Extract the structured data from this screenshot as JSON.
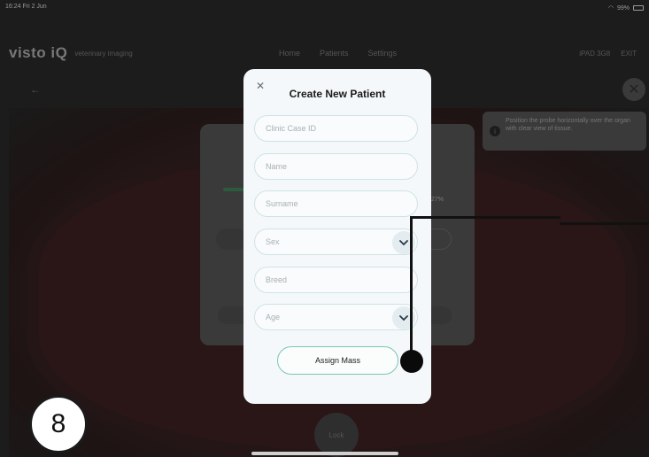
{
  "status_bar": {
    "time": "16:24  Fri 2 Jun",
    "battery": "99%"
  },
  "app": {
    "logo": "visto iQ",
    "logo_sub": "veterinary imaging",
    "nav": [
      "Home",
      "Patients",
      "Settings"
    ],
    "right_items": [
      "iPAD 3G8",
      "EXIT"
    ]
  },
  "info_box": {
    "text": "Position the probe horizontally over the organ with clear view of tissue."
  },
  "background_card": {
    "progress_label": "27%"
  },
  "modal": {
    "title": "Create New Patient",
    "close_icon": "close-icon",
    "fields": {
      "clinic_case_id": {
        "placeholder": "Clinic Case ID",
        "value": ""
      },
      "name": {
        "placeholder": "Name",
        "value": ""
      },
      "surname": {
        "placeholder": "Surname",
        "value": ""
      },
      "sex": {
        "selected": "Sex"
      },
      "breed": {
        "placeholder": "Breed",
        "value": ""
      },
      "age": {
        "selected": "Age"
      }
    },
    "assign_button": "Assign Mass"
  },
  "lock_button": {
    "label": "Lock"
  },
  "annotation": {
    "step_number": "8"
  },
  "colors": {
    "accent": "#79c6b0",
    "modal_bg": "#f5f8fa",
    "overlay": "#1c1c1c"
  }
}
